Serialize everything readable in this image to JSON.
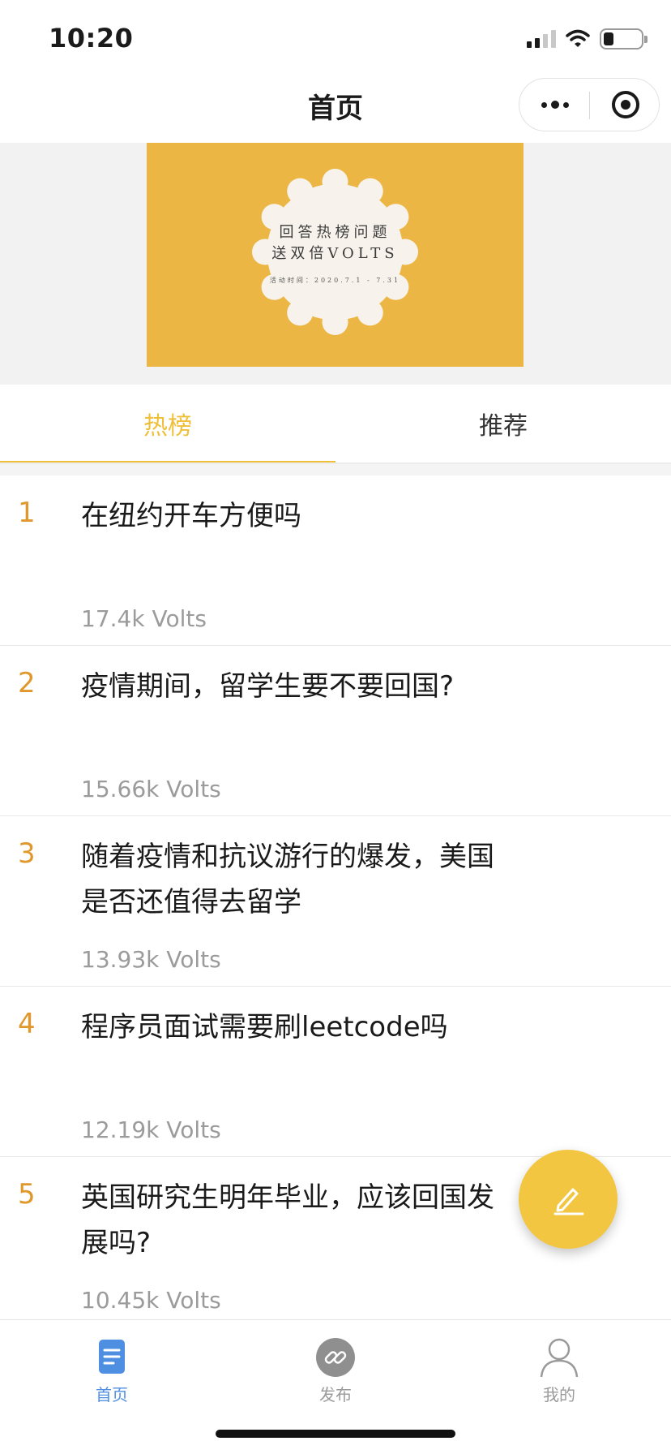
{
  "status_bar": {
    "time": "10:20",
    "icons": [
      "signal-icon",
      "wifi-icon",
      "battery-icon"
    ]
  },
  "nav": {
    "title": "首页",
    "capsule_icons": [
      "more-icon",
      "target-icon"
    ]
  },
  "banner": {
    "line1": "回答热榜问题",
    "line2": "送双倍VOLTS",
    "line3": "活动时间：2020.7.1 - 7.31",
    "bg_color": "#ecb645"
  },
  "tabs": [
    {
      "label": "热榜",
      "active": true
    },
    {
      "label": "推荐",
      "active": false
    }
  ],
  "hot_list": [
    {
      "rank": "1",
      "question": "在纽约开车方便吗",
      "volts": "17.4k Volts"
    },
    {
      "rank": "2",
      "question": "疫情期间，留学生要不要回国?",
      "volts": "15.66k Volts"
    },
    {
      "rank": "3",
      "question": "随着疫情和抗议游行的爆发，美国是否还值得去留学",
      "volts": "13.93k Volts"
    },
    {
      "rank": "4",
      "question": "程序员面试需要刷leetcode吗",
      "volts": "12.19k Volts"
    },
    {
      "rank": "5",
      "question": "英国研究生明年毕业，应该回国发展吗?",
      "volts": "10.45k Volts"
    }
  ],
  "fab": {
    "icon": "pen-icon",
    "color": "#f2c640"
  },
  "tab_bar": [
    {
      "label": "首页",
      "icon": "document-icon",
      "active": true
    },
    {
      "label": "发布",
      "icon": "link-icon",
      "active": false
    },
    {
      "label": "我的",
      "icon": "user-icon",
      "active": false
    }
  ],
  "colors": {
    "accent": "#f0bf3a",
    "rank": "#e0982c",
    "tabbar_active": "#4f8fe2"
  }
}
